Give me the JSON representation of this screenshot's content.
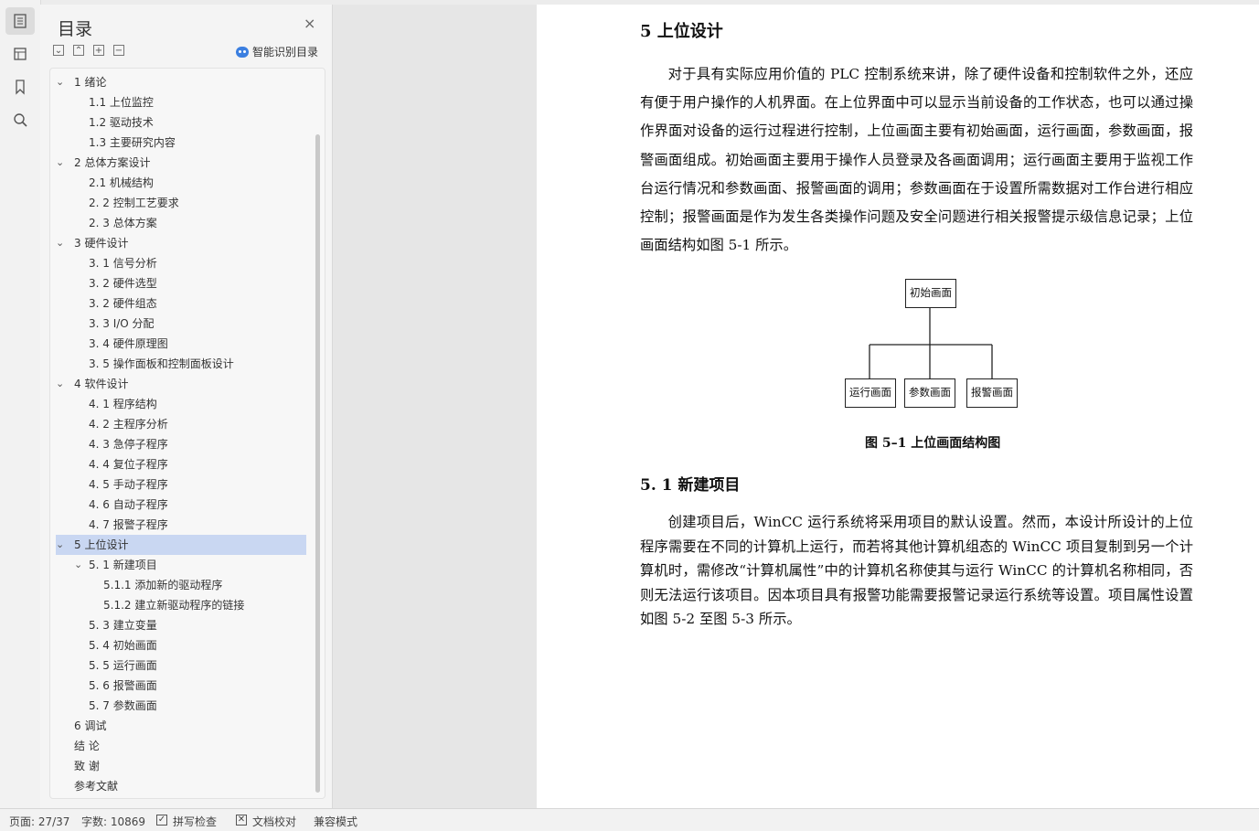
{
  "toc": {
    "title": "目录",
    "smart_toc_label": "智能识别目录",
    "items": [
      {
        "level": 0,
        "expanded": true,
        "label": "1 绪论"
      },
      {
        "level": 1,
        "label": "1.1 上位监控"
      },
      {
        "level": 1,
        "label": "1.2 驱动技术"
      },
      {
        "level": 1,
        "label": "1.3 主要研究内容"
      },
      {
        "level": 0,
        "expanded": true,
        "label": "2  总体方案设计"
      },
      {
        "level": 1,
        "label": "2.1  机械结构"
      },
      {
        "level": 1,
        "label": "2. 2 控制工艺要求"
      },
      {
        "level": 1,
        "label": "2. 3 总体方案"
      },
      {
        "level": 0,
        "expanded": true,
        "label": "3 硬件设计"
      },
      {
        "level": 1,
        "label": "3. 1    信号分析"
      },
      {
        "level": 1,
        "label": "3. 2    硬件选型"
      },
      {
        "level": 1,
        "label": "3. 2    硬件组态"
      },
      {
        "level": 1,
        "label": "3. 3  I/O 分配"
      },
      {
        "level": 1,
        "label": "3. 4  硬件原理图"
      },
      {
        "level": 1,
        "label": "3. 5  操作面板和控制面板设计"
      },
      {
        "level": 0,
        "expanded": true,
        "label": "4  软件设计"
      },
      {
        "level": 1,
        "label": "4. 1    程序结构"
      },
      {
        "level": 1,
        "label": "4. 2    主程序分析"
      },
      {
        "level": 1,
        "label": "4. 3  急停子程序"
      },
      {
        "level": 1,
        "label": "4. 4  复位子程序"
      },
      {
        "level": 1,
        "label": "4. 5  手动子程序"
      },
      {
        "level": 1,
        "label": "4. 6  自动子程序"
      },
      {
        "level": 1,
        "label": "4. 7  报警子程序"
      },
      {
        "level": 0,
        "expanded": true,
        "selected": true,
        "label": "5   上位设计"
      },
      {
        "level": 1,
        "expanded": true,
        "label": "5. 1    新建项目"
      },
      {
        "level": 2,
        "label": "5.1.1  添加新的驱动程序"
      },
      {
        "level": 2,
        "label": "5.1.2 建立新驱动程序的链接"
      },
      {
        "level": 1,
        "label": "5. 3 建立变量"
      },
      {
        "level": 1,
        "label": "5. 4  初始画面"
      },
      {
        "level": 1,
        "label": "5. 5   运行画面"
      },
      {
        "level": 1,
        "label": "5. 6   报警画面"
      },
      {
        "level": 1,
        "label": "5. 7   参数画面"
      },
      {
        "level": 0,
        "label": "6 调试"
      },
      {
        "level": 0,
        "label": "结    论"
      },
      {
        "level": 0,
        "label": "致    谢"
      },
      {
        "level": 0,
        "label": "参考文献"
      }
    ]
  },
  "document": {
    "heading": "5  上位设计",
    "para1": "对于具有实际应用价值的 PLC 控制系统来讲，除了硬件设备和控制软件之外，还应有便于用户操作的人机界面。在上位界面中可以显示当前设备的工作状态，也可以通过操作界面对设备的运行过程进行控制，上位画面主要有初始画面，运行画面，参数画面，报警画面组成。初始画面主要用于操作人员登录及各画面调用；运行画面主要用于监视工作台运行情况和参数画面、报警画面的调用；参数画面在于设置所需数据对工作台进行相应控制；报警画面是作为发生各类操作问题及安全问题进行相关报警提示级信息记录；上位画面结构如图 5-1 所示。",
    "diagram": {
      "root": "初始画面",
      "children": [
        "运行画面",
        "参数画面",
        "报警画面"
      ]
    },
    "caption": "图 5–1 上位画面结构图",
    "subheading": "5. 1    新建项目",
    "para2": "创建项目后，WinCC 运行系统将采用项目的默认设置。然而，本设计所设计的上位程序需要在不同的计算机上运行，而若将其他计算机组态的 WinCC 项目复制到另一个计算机时，需修改“计算机属性”中的计算机名称使其与运行 WinCC 的计算机名称相同，否则无法运行该项目。因本项目具有报警功能需要报警记录运行系统等设置。项目属性设置如图 5-2 至图 5-3 所示。"
  },
  "status": {
    "page": "页面: 27/37",
    "words": "字数: 10869",
    "spell": "拼写检查",
    "proof": "文档校对",
    "compat": "兼容模式"
  }
}
